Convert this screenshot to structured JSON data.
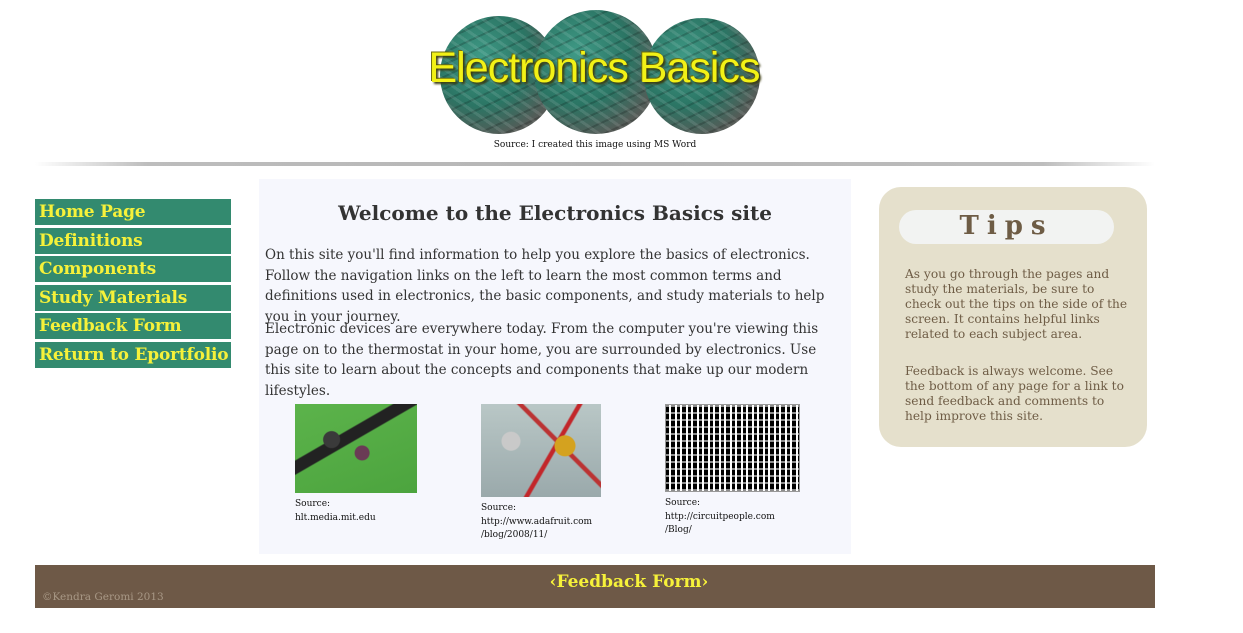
{
  "header": {
    "logo_text": "Electronics Basics",
    "logo_caption": "Source: I created this image using MS Word"
  },
  "nav": {
    "items": [
      {
        "label": "Home Page"
      },
      {
        "label": "Definitions"
      },
      {
        "label": "Components"
      },
      {
        "label": "Study Materials"
      },
      {
        "label": "Feedback Form"
      },
      {
        "label": "Return to Eportfolio"
      }
    ]
  },
  "main": {
    "title": "Welcome to the Electronics Basics site",
    "paragraphs": [
      "On this site you'll find information to help you explore the basics of electronics. Follow the navigation links on the left to learn the most common terms and definitions used in electronics, the basic components, and study materials to help you in your journey.",
      "Electronic devices are everywhere today. From the computer you're viewing this page on to the thermostat in your home, you are surrounded by electronics. Use this site to learn about the concepts and components that make up our modern lifestyles."
    ],
    "images": [
      {
        "caption_lines": [
          "Source:",
          "hlt.media.mit.edu"
        ]
      },
      {
        "caption_lines": [
          "Source:",
          "http://www.adafruit.com",
          "/blog/2008/11/"
        ]
      },
      {
        "caption_lines": [
          "Source:",
          "http://circuitpeople.com",
          "/Blog/"
        ]
      }
    ]
  },
  "tips": {
    "title": "Tips",
    "paragraphs": [
      "As you go through the pages and study the materials, be sure to check out the tips on the side of the screen. It contains helpful links related to each subject area.",
      "Feedback is always welcome. See the bottom of any page for a link to send feedback and comments to help improve this site."
    ]
  },
  "footer": {
    "copyright": "©Kendra Geromi 2013",
    "feedback_link": "‹Feedback Form›"
  },
  "colors": {
    "nav_bg": "#338a6f",
    "nav_text": "#f6f13a",
    "main_bg": "#f6f7fd",
    "tips_bg": "#e5e0cc",
    "tips_text": "#6e5c45",
    "footer_bg": "#6e5947"
  }
}
